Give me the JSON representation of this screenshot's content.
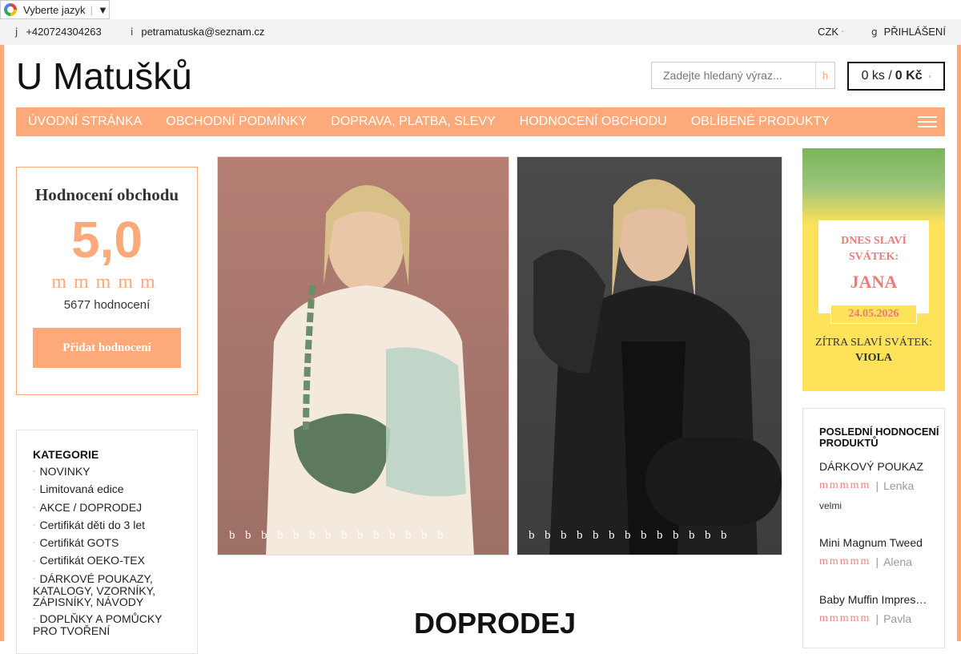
{
  "language": {
    "label": "Vyberte jazyk",
    "arrow": "▼"
  },
  "topbar": {
    "phone_glyph": "j",
    "phone": "+420724304263",
    "email_glyph": "i",
    "email": "petramatuska@seznam.cz",
    "currency": "CZK",
    "currency_glyph": "▫",
    "login_glyph": "g",
    "login": "PŘIHLÁŠENÍ"
  },
  "header": {
    "logo": "U Matušků",
    "search_placeholder": "Zadejte hledaný výraz...",
    "search_glyph": "h",
    "cart_count": "0 ks /",
    "cart_total": "0 Kč",
    "cart_glyph": "▫"
  },
  "nav": {
    "items": [
      "ÚVODNÍ STRÁNKA",
      "OBCHODNÍ PODMÍNKY",
      "DOPRAVA, PLATBA, SLEVY",
      "HODNOCENÍ OBCHODU",
      "OBLÍBENÉ PRODUKTY"
    ]
  },
  "rating": {
    "title": "Hodnocení obchodu",
    "score": "5,0",
    "stars": "mmmmm",
    "count": "5677 hodnocení",
    "button": "Přidat hodnocení"
  },
  "categories": {
    "title": "KATEGORIE",
    "bullet": "▫",
    "items": [
      "NOVINKY",
      "Limitovaná edice",
      "AKCE / DOPRODEJ",
      "Certifikát děti do 3 let",
      "Certifikát GOTS",
      "Certifikát OEKO-TEX",
      "DÁRKOVÉ POUKAZY, KATALOGY, VZORNÍKY, ZÁPISNÍKY, NÁVODY",
      "DOPLŇKY A POMŮCKY PRO TVOŘENÍ"
    ]
  },
  "slider": {
    "dots_left": "bbbbbbbbbbbbbb",
    "dots_right": "bbbbbbbbbbbbb"
  },
  "section_title": "DOPRODEJ",
  "namesday": {
    "today_label": "DNES SLAVÍ SVÁTEK:",
    "today_name": "JANA",
    "date": "24.05.2026",
    "tomorrow_label": "ZÍTRA SLAVÍ SVÁTEK:",
    "tomorrow_name": "VIOLA"
  },
  "reviews": {
    "title": "POSLEDNÍ HODNOCENÍ PRODUKTŮ",
    "items": [
      {
        "product": "DÁRKOVÝ POUKAZ",
        "stars": "mmmmm",
        "author": "Lenka",
        "text": "velmi"
      },
      {
        "product": "Mini Magnum Tweed",
        "stars": "mmmmm",
        "author": "Alena",
        "text": ""
      },
      {
        "product": "Baby Muffin Impressions",
        "stars": "mmmmm",
        "author": "Pavla",
        "text": ""
      }
    ]
  },
  "colors": {
    "accent": "#fda97a",
    "star_review": "#f08080",
    "namesday_bg": "#fde25a"
  }
}
